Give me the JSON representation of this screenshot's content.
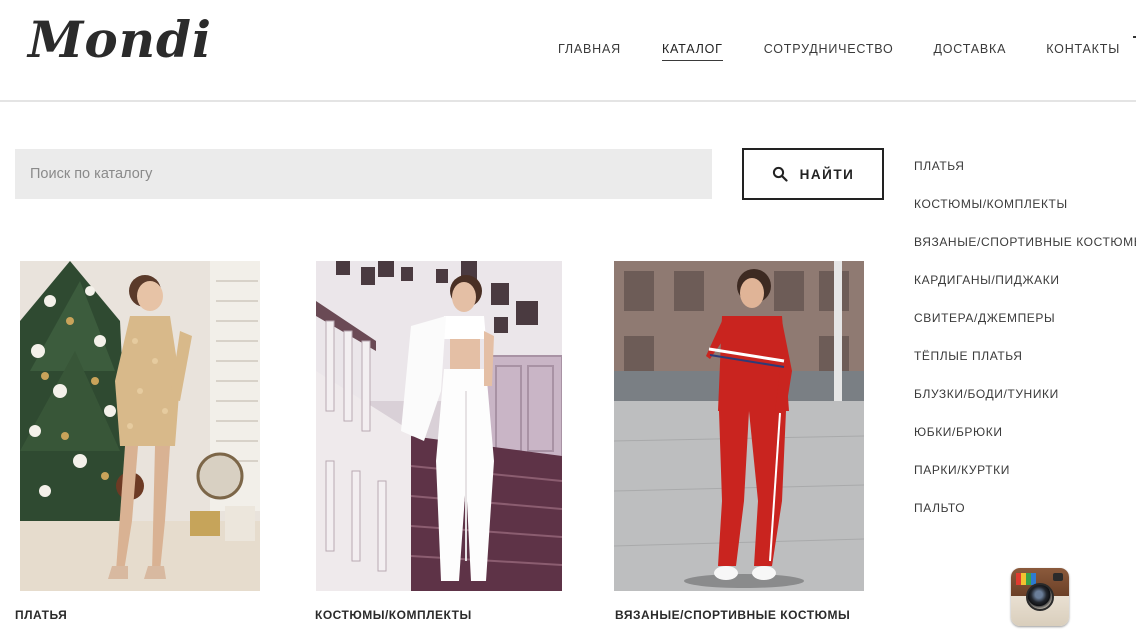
{
  "header": {
    "logo": "Mondi",
    "nav": [
      {
        "label": "ГЛАВНАЯ",
        "active": false
      },
      {
        "label": "КАТАЛОГ",
        "active": true
      },
      {
        "label": "СОТРУДНИЧЕСТВО",
        "active": false
      },
      {
        "label": "ДОСТАВКА",
        "active": false
      },
      {
        "label": "КОНТАКТЫ",
        "active": false
      }
    ]
  },
  "search": {
    "placeholder": "Поиск по каталогу",
    "value": "",
    "button_label": "НАЙТИ",
    "button_icon": "search-icon"
  },
  "sidebar": {
    "categories": [
      "ПЛАТЬЯ",
      "КОСТЮМЫ/КОМПЛЕКТЫ",
      "ВЯЗАНЫЕ/СПОРТИВНЫЕ КОСТЮМЫ",
      "КАРДИГАНЫ/ПИДЖАКИ",
      "СВИТЕРА/ДЖЕМПЕРЫ",
      "ТЁПЛЫЕ ПЛАТЬЯ",
      "БЛУЗКИ/БОДИ/ТУНИКИ",
      "ЮБКИ/БРЮКИ",
      "ПАРКИ/КУРТКИ",
      "ПАЛЬТО"
    ]
  },
  "products": [
    {
      "title": "ПЛАТЬЯ",
      "image": "gold-sequin-dress-photo"
    },
    {
      "title": "КОСТЮМЫ/КОМПЛЕКТЫ",
      "image": "white-suit-photo"
    },
    {
      "title": "ВЯЗАНЫЕ/СПОРТИВНЫЕ КОСТЮМЫ",
      "image": "red-tracksuit-photo"
    }
  ],
  "social": {
    "icon": "instagram-icon"
  },
  "colors": {
    "text": "#222222",
    "search_bg": "#ebebeb",
    "header_border": "#e4e4e4"
  }
}
